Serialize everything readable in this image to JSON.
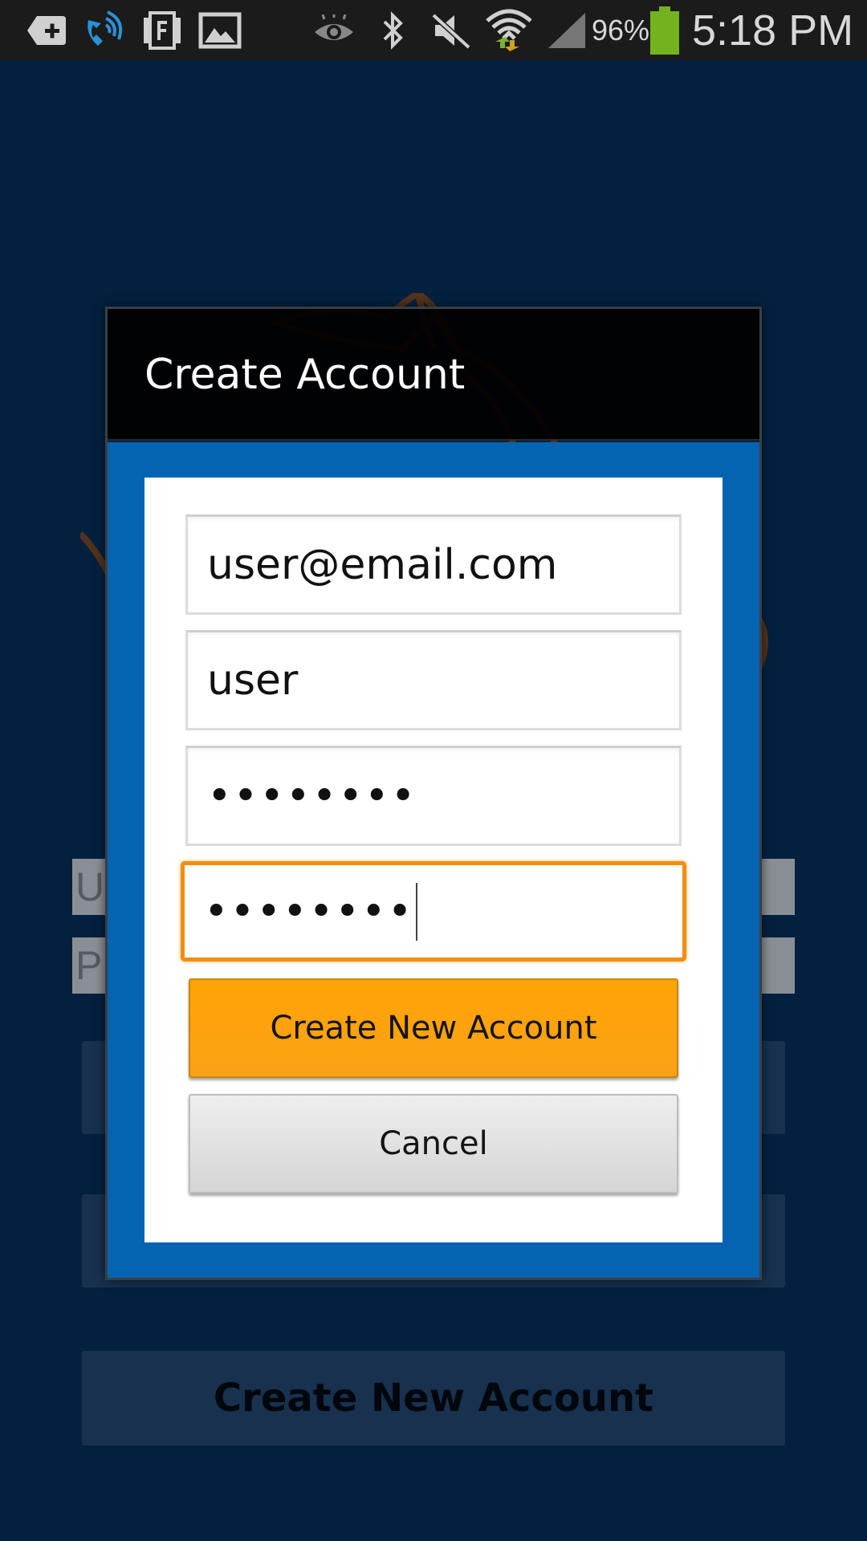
{
  "status_bar": {
    "icons": [
      "add-notification-icon",
      "wifi-call-icon",
      "flipboard-icon",
      "gallery-icon",
      "eye-icon",
      "bluetooth-icon",
      "mute-icon",
      "wifi-icon",
      "signal-icon",
      "battery-icon"
    ],
    "battery_percent": "96%",
    "time": "5:18 PM",
    "colors": {
      "battery": "#74b31f",
      "wifi_arrows": "#7ab330"
    }
  },
  "background": {
    "username_field_partial": "U",
    "password_field_partial": "P",
    "create_button_label": "Create New Account",
    "colors": {
      "page": "#03213f",
      "logo_stroke": "#7a3c12"
    }
  },
  "dialog": {
    "title": "Create Account",
    "fields": {
      "email": "user@email.com",
      "username": "user",
      "password": "••••••••",
      "confirm_password": "••••••••"
    },
    "buttons": {
      "create": "Create New Account",
      "cancel": "Cancel"
    },
    "colors": {
      "body": "#0564b1",
      "create_button": "#ffa405",
      "focus_border": "#f08f12"
    }
  }
}
